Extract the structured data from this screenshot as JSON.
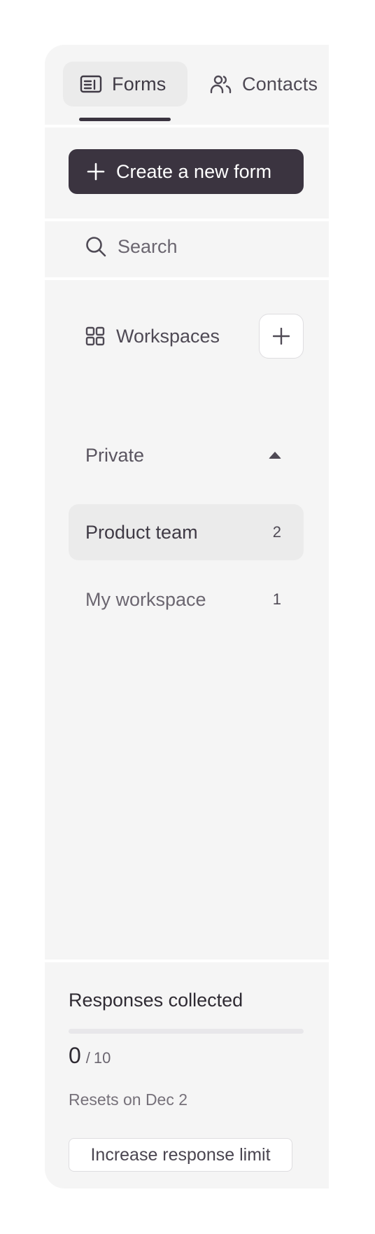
{
  "tabs": [
    {
      "label": "Forms",
      "icon": "form-icon",
      "active": true
    },
    {
      "label": "Contacts",
      "icon": "contacts-icon",
      "active": false
    }
  ],
  "create_button": {
    "label": "Create a new form",
    "icon": "plus-icon"
  },
  "search": {
    "placeholder": "Search",
    "value": "",
    "icon": "search-icon"
  },
  "workspaces": {
    "title": "Workspaces",
    "icon": "grid-icon",
    "add_icon": "plus-icon",
    "group": {
      "label": "Private",
      "expanded": true
    },
    "items": [
      {
        "label": "Product team",
        "count": "2",
        "selected": true
      },
      {
        "label": "My workspace",
        "count": "1",
        "selected": false
      }
    ]
  },
  "responses": {
    "title": "Responses collected",
    "collected": "0",
    "separator": "/",
    "limit": "10",
    "progress_fraction": 0,
    "resets": "Resets on Dec 2",
    "increase_label": "Increase response limit"
  },
  "colors": {
    "accent": "#3b3440",
    "sidebar_bg": "#f5f5f5",
    "selected_bg": "#ebebeb"
  }
}
